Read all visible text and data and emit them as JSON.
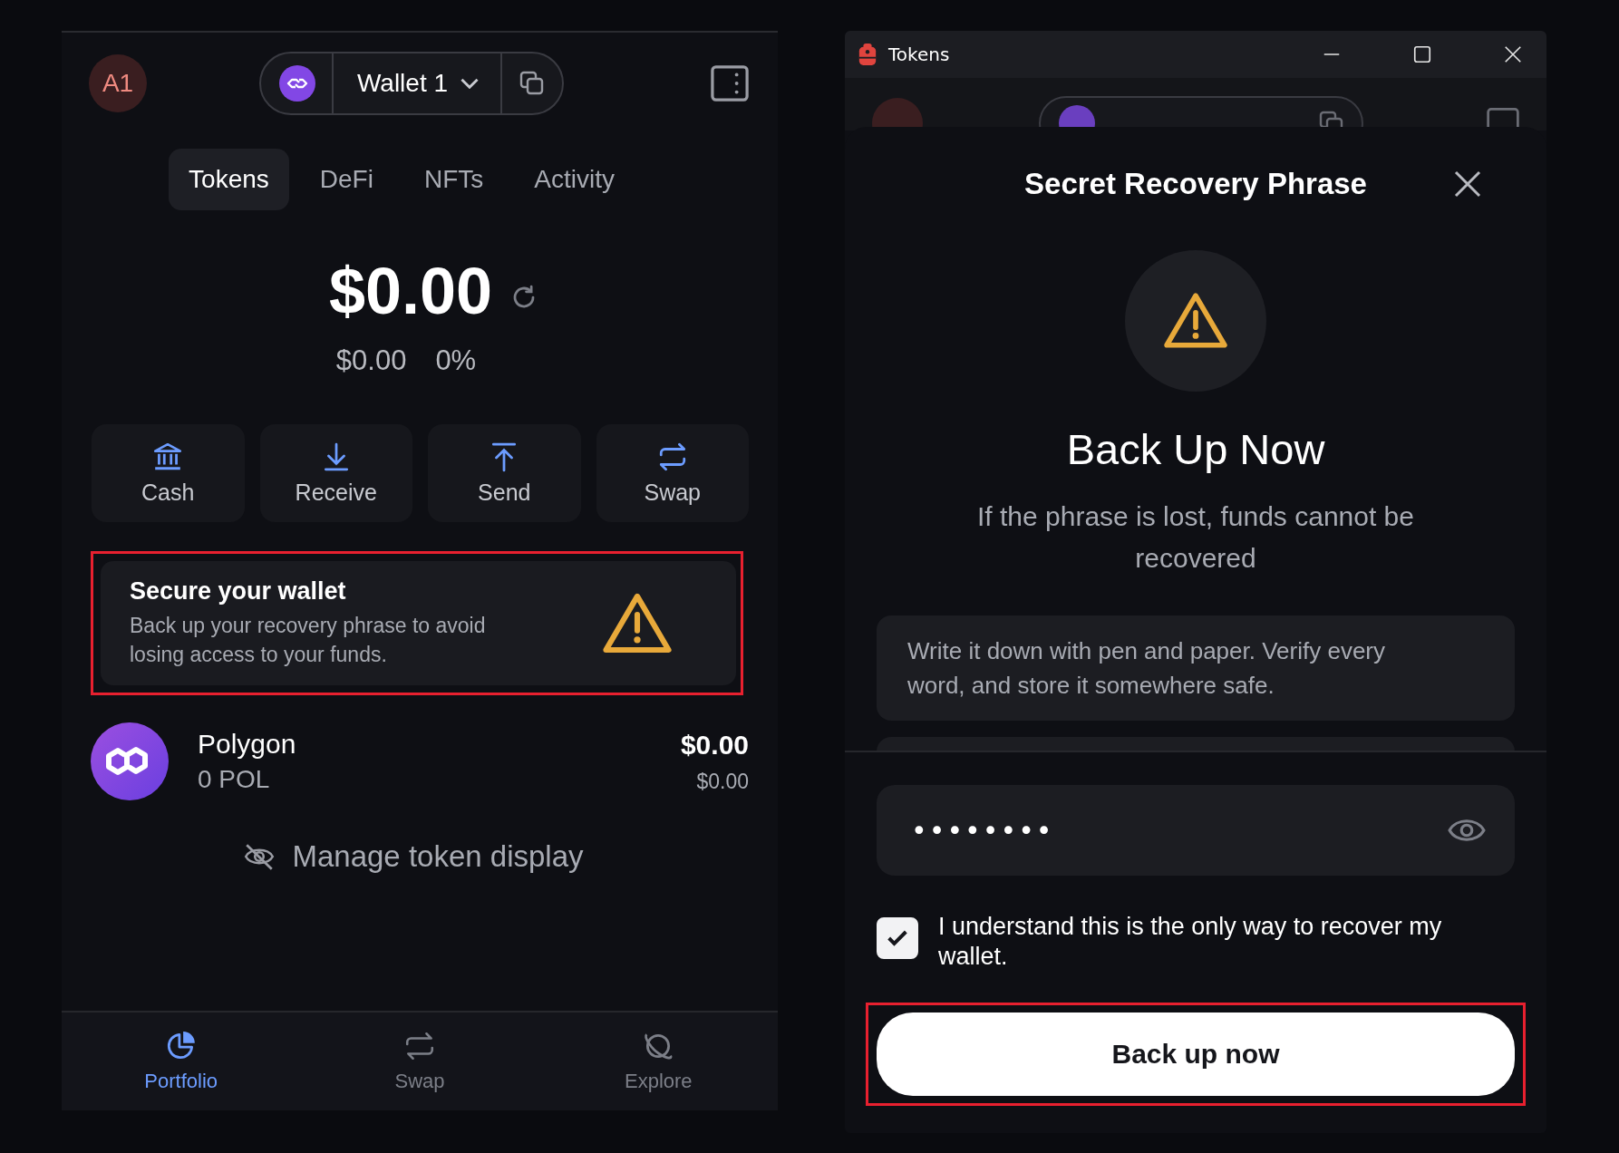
{
  "wallet_panel": {
    "avatar": "A1",
    "wallet_name": "Wallet 1",
    "tabs": [
      {
        "label": "Tokens",
        "selected": true
      },
      {
        "label": "DeFi",
        "selected": false
      },
      {
        "label": "NFTs",
        "selected": false
      },
      {
        "label": "Activity",
        "selected": false
      }
    ],
    "balance": "$0.00",
    "change_amount": "$0.00",
    "change_percent": "0%",
    "actions": [
      {
        "label": "Cash",
        "kind": "cash"
      },
      {
        "label": "Receive",
        "kind": "receive"
      },
      {
        "label": "Send",
        "kind": "send"
      },
      {
        "label": "Swap",
        "kind": "swap"
      }
    ],
    "backup_card": {
      "title": "Secure your wallet",
      "text": "Back up your recovery phrase to avoid losing access to your funds.",
      "highlighted": true
    },
    "tokens": [
      {
        "name": "Polygon",
        "amount": "0 POL",
        "value": "$0.00",
        "fiat_value": "$0.00"
      }
    ],
    "manage_link": "Manage token display",
    "bottom_nav": [
      {
        "label": "Portfolio",
        "kind": "portfolio",
        "selected": true
      },
      {
        "label": "Swap",
        "kind": "swap",
        "selected": false
      },
      {
        "label": "Explore",
        "kind": "explore",
        "selected": false
      }
    ]
  },
  "backup_window": {
    "title": "Tokens",
    "sheet": {
      "title": "Secret Recovery Phrase",
      "heading": "Back Up Now",
      "warning": "If the phrase is lost, funds cannot be recovered",
      "tip": "Write it down with pen and paper. Verify every word, and store it somewhere safe.",
      "password": {
        "value": "••••••••"
      },
      "confirm": {
        "label": "I understand this is the only way to recover my wallet.",
        "checked": true
      },
      "button": {
        "label": "Back up now",
        "highlighted": true
      }
    }
  }
}
